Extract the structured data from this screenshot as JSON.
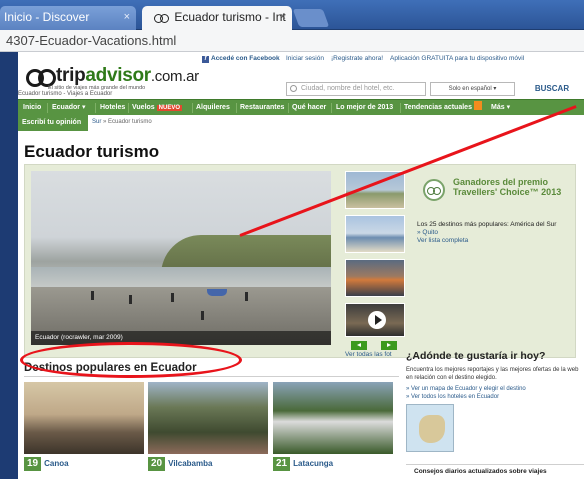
{
  "browser": {
    "tabs": [
      {
        "label": "Inicio - Discover"
      },
      {
        "label": "Ecuador turismo - Int"
      }
    ],
    "close_glyph": "×",
    "url": "4307-Ecuador-Vacations.html"
  },
  "topbar": {
    "facebook": "Accedé con Facebook",
    "login": "Iniciar sesión",
    "register": "¡Registrate ahora!",
    "app": "Aplicación GRATUITA para tu dispositivo móvil"
  },
  "header": {
    "logo_trip": "trip",
    "logo_advisor": "advisor",
    "logo_domain": ".com.ar",
    "tagline": "El sitio de viajes más grande del mundo",
    "breadcrumb_top": "Ecuador turismo - Viajes a Ecuador",
    "search_placeholder": "Ciudad, nombre del hotel, etc.",
    "lang_select": "Solo en español",
    "search_button": "BUSCAR"
  },
  "nav": {
    "items": [
      "Inicio",
      "Ecuador",
      "Hoteles",
      "Vuelos",
      "Alquileres",
      "Restaurantes",
      "Qué hacer",
      "Lo mejor de 2013",
      "Tendencias actuales",
      "Más"
    ],
    "nuevo_badge": "NUEVO",
    "dropdown_glyph": "▾",
    "escribi": "Escribí tu opinión",
    "breadcrumb_link": "Sur",
    "breadcrumb_sep": "»",
    "breadcrumb_current": "Ecuador turismo"
  },
  "main": {
    "title": "Ecuador turismo",
    "photo_caption": "Ecuador (rocrawler, mar 2009)",
    "ver_todas_fotos": "Ver todas las fot",
    "award_title": "Ganadores del premio Travellers' Choice™ 2013",
    "award_desc": "Los 25 destinos más populares: América del Sur",
    "award_links": [
      "» Quito",
      "Ver lista completa"
    ]
  },
  "destinos": {
    "title": "Destinos populares en Ecuador",
    "cards": [
      {
        "rank": "19",
        "name": "Canoa"
      },
      {
        "rank": "20",
        "name": "Vilcabamba"
      },
      {
        "rank": "21",
        "name": "Latacunga"
      }
    ]
  },
  "right": {
    "title": "¿Adónde te gustaría ir hoy?",
    "desc": "Encuentra los mejores reportajes y las mejores ofertas de la web en relación con el destino elegido.",
    "links": [
      "» Ver un mapa de Ecuador y elegir el destino",
      "» Ver todos los hoteles en Ecuador"
    ],
    "consejos": "Consejos diarios actualizados sobre viajes"
  },
  "colors": {
    "brand_green": "#589442",
    "link_blue": "#2a5a8a",
    "annotation_red": "#e8141b"
  }
}
